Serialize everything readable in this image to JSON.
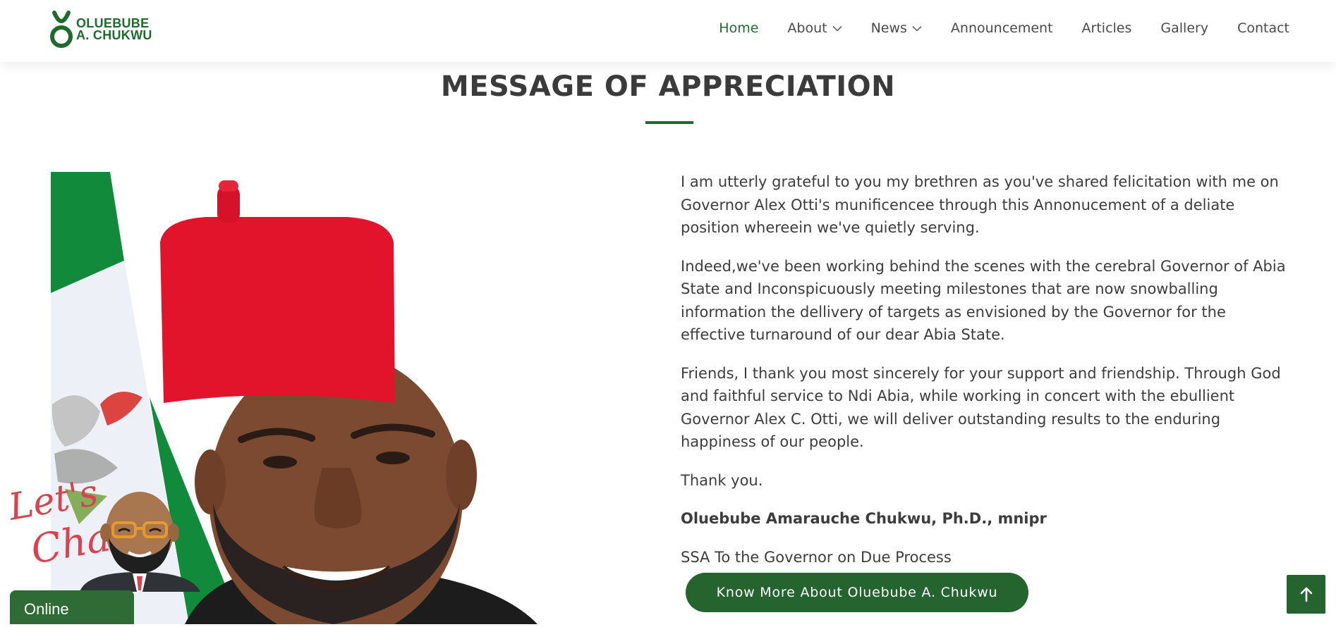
{
  "colors": {
    "brand_green": "#1e6b2e",
    "button_green": "#25632f",
    "text": "#3d3d3d",
    "flag_green": "#118a3b",
    "cap_red": "#e2142b"
  },
  "header": {
    "logo": {
      "line1": "OLUEBUBE",
      "line2": "A. CHUKWU"
    },
    "nav": [
      {
        "label": "Home",
        "active": true
      },
      {
        "label": "About",
        "dropdown": true
      },
      {
        "label": "News",
        "dropdown": true
      },
      {
        "label": "Announcement"
      },
      {
        "label": "Articles"
      },
      {
        "label": "Gallery"
      },
      {
        "label": "Contact"
      }
    ]
  },
  "section": {
    "title": "MESSAGE OF APPRECIATION"
  },
  "message": {
    "paragraphs": [
      "I am utterly grateful to you my brethren as you've shared felicitation with me on Governor Alex Otti's munificencee through this Annonucement of a deliate position whereein we've quietly serving.",
      "Indeed,we've been working behind the scenes with the cerebral Governor of Abia State and Inconspicuously meeting milestones that are now snowballing information the dellivery of targets as envisioned by the Governor for the effective turnaround of our dear Abia State.",
      "Friends, I thank you most sincerely for your support and friendship. Through God and faithful service to Ndi Abia, while working in concert with the ebullient Governor Alex C. Otti, we will deliver outstanding results to the enduring happiness of our people.",
      "Thank you."
    ],
    "signature_name": "Oluebube Amarauche Chukwu, Ph.D., mnipr",
    "signature_role": "SSA To the Governor on Due Process",
    "cta_label": "Know More About Oluebube A. Chukwu"
  },
  "chat": {
    "line1": "Let's",
    "line2": "Chat",
    "status": "Online"
  },
  "icons": {
    "nav_dropdown": "chevron-down-icon",
    "back_to_top": "arrow-up-icon"
  }
}
